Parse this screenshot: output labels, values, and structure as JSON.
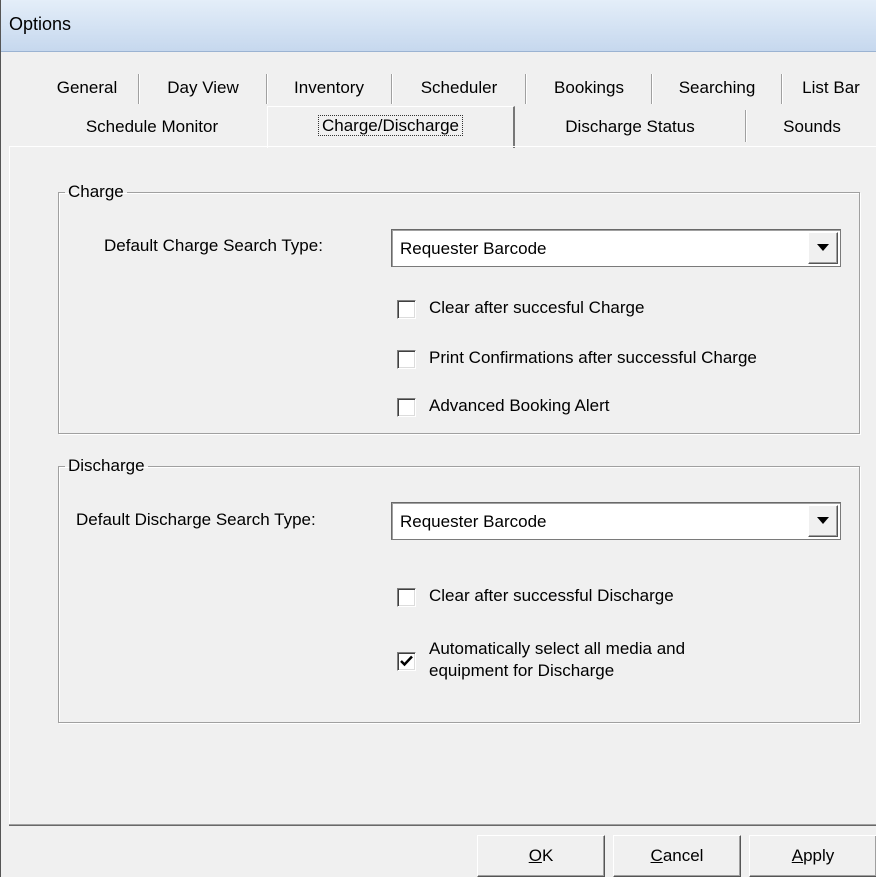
{
  "window": {
    "title": "Options"
  },
  "tabs": {
    "row1": [
      "General",
      "Day View",
      "Inventory",
      "Scheduler",
      "Bookings",
      "Searching",
      "List Bar"
    ],
    "row2": [
      "Schedule Monitor",
      "Charge/Discharge",
      "Discharge Status",
      "Sounds"
    ],
    "active": "Charge/Discharge"
  },
  "charge": {
    "legend": "Charge",
    "search_type_label": "Default Charge Search Type:",
    "search_type_value": "Requester Barcode",
    "options": [
      {
        "label": "Clear after succesful Charge",
        "checked": false
      },
      {
        "label": "Print Confirmations after successful Charge",
        "checked": false
      },
      {
        "label": "Advanced Booking Alert",
        "checked": false
      }
    ]
  },
  "discharge": {
    "legend": "Discharge",
    "search_type_label": "Default Discharge Search Type:",
    "search_type_value": "Requester Barcode",
    "options": [
      {
        "label": "Clear after successful Discharge",
        "checked": false
      },
      {
        "label_line1": "Automatically select all media and",
        "label_line2": "equipment for Discharge",
        "checked": true
      }
    ]
  },
  "buttons": {
    "ok": {
      "mnemonic": "O",
      "rest": "K"
    },
    "cancel": {
      "mnemonic": "C",
      "rest": "ancel"
    },
    "apply": {
      "mnemonic": "A",
      "rest": "pply"
    }
  },
  "icons": {
    "dropdown": "chevron-down-icon",
    "checkmark": "checkmark-icon"
  }
}
